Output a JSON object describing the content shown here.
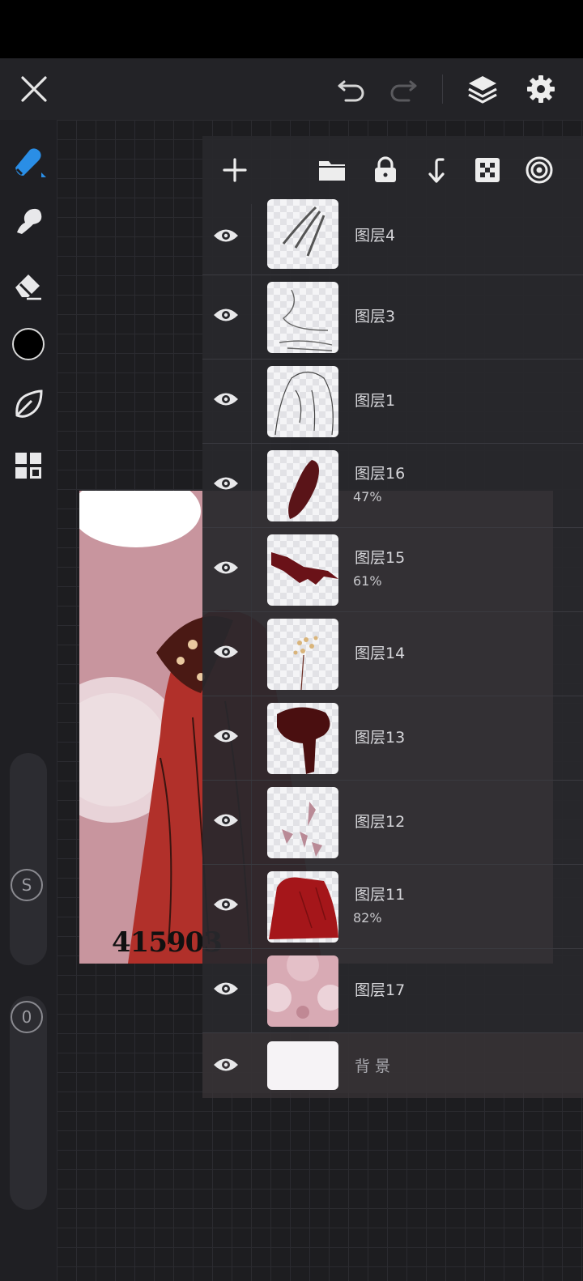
{
  "topbar": {
    "close": "close-icon",
    "undo": "undo-icon",
    "redo": "redo-icon",
    "layers": "layers-icon",
    "settings": "gear-icon"
  },
  "left_tools": [
    "brush-icon",
    "smudge-icon",
    "eraser-icon",
    "color-swatch",
    "leaf-icon",
    "grid-icon"
  ],
  "sliders": {
    "size_label": "S",
    "opacity_label": "0"
  },
  "artwork": {
    "signature": "415903"
  },
  "panel_tools": [
    "add-icon",
    "folder-icon",
    "lock-icon",
    "merge-down-icon",
    "alpha-icon",
    "target-icon"
  ],
  "layers": [
    {
      "name": "图层4",
      "opacity": ""
    },
    {
      "name": "图层3",
      "opacity": ""
    },
    {
      "name": "图层1",
      "opacity": ""
    },
    {
      "name": "图层16",
      "opacity": "47%"
    },
    {
      "name": "图层15",
      "opacity": "61%"
    },
    {
      "name": "图层14",
      "opacity": ""
    },
    {
      "name": "图层13",
      "opacity": ""
    },
    {
      "name": "图层12",
      "opacity": ""
    },
    {
      "name": "图层11",
      "opacity": "82%"
    },
    {
      "name": "图层17",
      "opacity": ""
    },
    {
      "name": "背景",
      "opacity": ""
    }
  ],
  "colors": {
    "accent": "#2a8ee6",
    "primary_color": "#000000"
  }
}
